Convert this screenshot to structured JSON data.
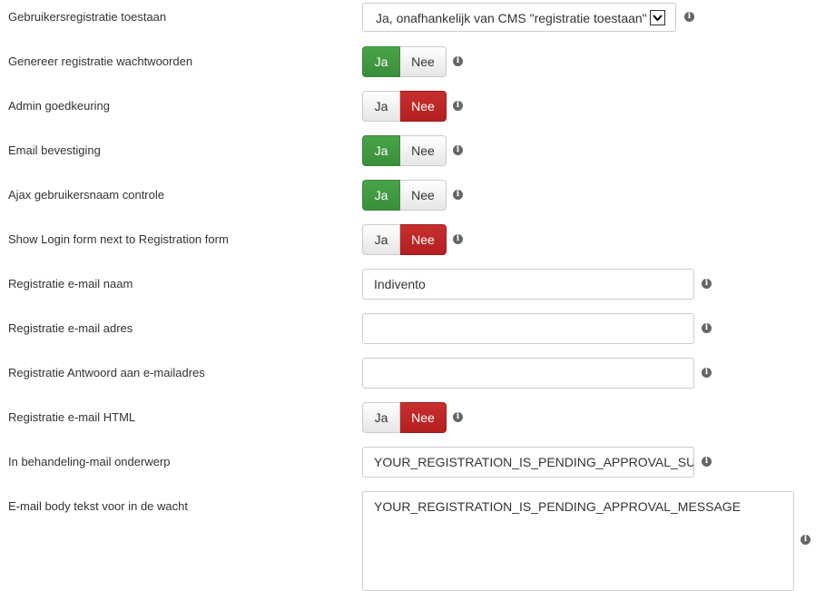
{
  "fields": [
    {
      "label": "Gebruikersregistratie toestaan",
      "type": "select",
      "value": "Ja, onafhankelijk van CMS \"registratie toestaan\""
    },
    {
      "label": "Genereer registratie wachtwoorden",
      "type": "toggle",
      "selected": "Ja"
    },
    {
      "label": "Admin goedkeuring",
      "type": "toggle",
      "selected": "Nee"
    },
    {
      "label": "Email bevestiging",
      "type": "toggle",
      "selected": "Ja"
    },
    {
      "label": "Ajax gebruikersnaam controle",
      "type": "toggle",
      "selected": "Ja"
    },
    {
      "label": "Show Login form next to Registration form",
      "type": "toggle",
      "selected": "Nee"
    },
    {
      "label": "Registratie e-mail naam",
      "type": "text",
      "value": "Indivento"
    },
    {
      "label": "Registratie e-mail adres",
      "type": "text",
      "value": ""
    },
    {
      "label": "Registratie Antwoord aan e-mailadres",
      "type": "text",
      "value": ""
    },
    {
      "label": "Registratie e-mail HTML",
      "type": "toggle",
      "selected": "Nee"
    },
    {
      "label": "In behandeling-mail onderwerp",
      "type": "text",
      "value": "YOUR_REGISTRATION_IS_PENDING_APPROVAL_SUBJECT"
    },
    {
      "label": "E-mail body tekst voor in de wacht",
      "type": "textarea",
      "value": "YOUR_REGISTRATION_IS_PENDING_APPROVAL_MESSAGE"
    }
  ],
  "toggle_labels": {
    "yes": "Ja",
    "no": "Nee"
  },
  "info_icon_glyph": "i",
  "colors": {
    "toggle_yes_active": "#3f9c3f",
    "toggle_no_active": "#bd2626",
    "label_text": "#333333"
  }
}
